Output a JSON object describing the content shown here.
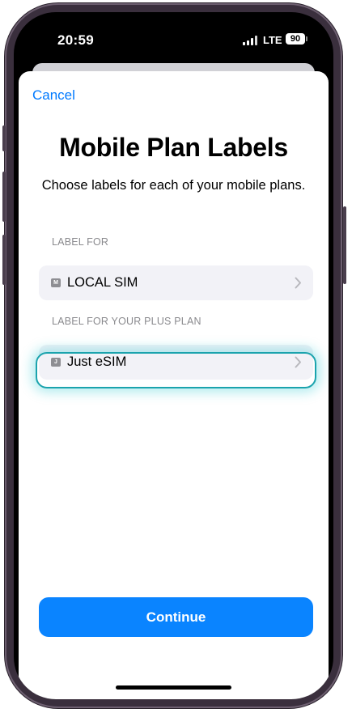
{
  "status_bar": {
    "time": "20:59",
    "network": "LTE",
    "battery": "90"
  },
  "sheet": {
    "cancel_label": "Cancel",
    "title": "Mobile Plan Labels",
    "subtitle": "Choose labels for each of your mobile plans.",
    "sections": [
      {
        "header": "LABEL FOR",
        "row": {
          "badge": "M",
          "label": "LOCAL SIM",
          "icon": "chevron-right-icon"
        }
      },
      {
        "header": "LABEL FOR YOUR PLUS PLAN",
        "row": {
          "badge": "J",
          "label": "Just eSIM",
          "icon": "chevron-right-icon"
        }
      }
    ],
    "continue_label": "Continue"
  },
  "colors": {
    "accent": "#007aff",
    "button": "#0a84ff",
    "highlight": "#1aa3ad",
    "frame": "#3a2f3d"
  }
}
